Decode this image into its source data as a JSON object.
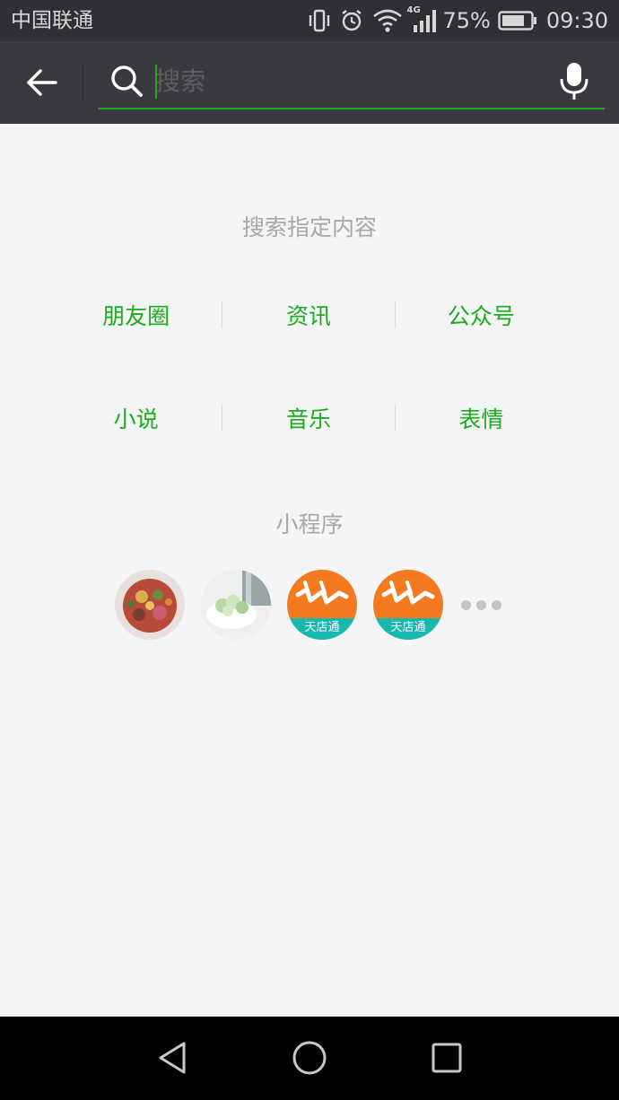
{
  "status_bar": {
    "carrier": "中国联通",
    "network": "4G",
    "battery_percent": "75%",
    "time": "09:30",
    "icons": [
      "vibrate-icon",
      "alarm-icon",
      "wifi-icon",
      "signal-icon",
      "battery-icon"
    ]
  },
  "toolbar": {
    "back_icon": "arrow-left-icon",
    "search_placeholder": "搜索",
    "search_value": "",
    "search_icon": "search-icon",
    "mic_icon": "microphone-icon",
    "accent_color": "#1aad19"
  },
  "main": {
    "search_specific_title": "搜索指定内容",
    "categories_row1": [
      "朋友圈",
      "资讯",
      "公众号"
    ],
    "categories_row2": [
      "小说",
      "音乐",
      "表情"
    ],
    "mini_programs_title": "小程序",
    "mini_programs": [
      {
        "icon": "food-photo-avatar"
      },
      {
        "icon": "dessert-photo-avatar"
      },
      {
        "icon": "tiandiantong-logo-avatar",
        "label": "天店通"
      },
      {
        "icon": "tiandiantong-logo-avatar",
        "label": "天店通"
      }
    ],
    "more_icon": "more-dots-icon"
  },
  "nav_bar": {
    "buttons": [
      "back-triangle-icon",
      "home-circle-icon",
      "recents-square-icon"
    ]
  }
}
